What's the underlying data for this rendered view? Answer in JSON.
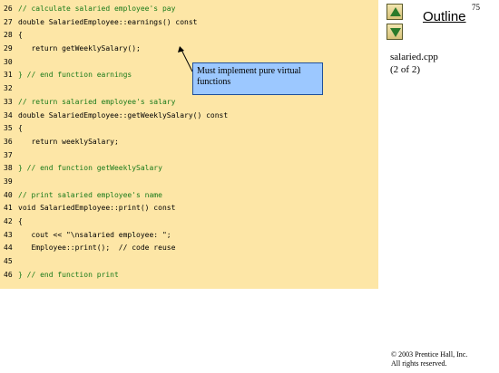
{
  "slide": {
    "page_number": "75",
    "outline_label": "Outline",
    "file_name": "salaried.cpp",
    "page_info": "(2 of 2)",
    "copyright": "© 2003 Prentice Hall, Inc.",
    "rights": "All rights reserved.",
    "callout": "Must implement pure virtual functions"
  },
  "code_lines": [
    {
      "num": "26",
      "text": "// calculate salaried employee's pay",
      "type": "cm"
    },
    {
      "num": "27",
      "text": "double SalariedEmployee::earnings() const",
      "type": "txt"
    },
    {
      "num": "28",
      "text": "{",
      "type": "txt"
    },
    {
      "num": "29",
      "text": "   return getWeeklySalary();",
      "type": "txt"
    },
    {
      "num": "30",
      "text": "",
      "type": "txt"
    },
    {
      "num": "31",
      "text": "} // end function earnings",
      "type": "cm"
    },
    {
      "num": "32",
      "text": "",
      "type": "txt"
    },
    {
      "num": "33",
      "text": "// return salaried employee's salary",
      "type": "cm"
    },
    {
      "num": "34",
      "text": "double SalariedEmployee::getWeeklySalary() const",
      "type": "txt"
    },
    {
      "num": "35",
      "text": "{",
      "type": "txt"
    },
    {
      "num": "36",
      "text": "   return weeklySalary;",
      "type": "txt"
    },
    {
      "num": "37",
      "text": "",
      "type": "txt"
    },
    {
      "num": "38",
      "text": "} // end function getWeeklySalary",
      "type": "cm"
    },
    {
      "num": "39",
      "text": "",
      "type": "txt"
    },
    {
      "num": "40",
      "text": "// print salaried employee's name",
      "type": "cm"
    },
    {
      "num": "41",
      "text": "void SalariedEmployee::print() const",
      "type": "txt"
    },
    {
      "num": "42",
      "text": "{",
      "type": "txt"
    },
    {
      "num": "43",
      "text": "   cout << \"\\nsalaried employee: \";",
      "type": "txt"
    },
    {
      "num": "44",
      "text": "   Employee::print();  // code reuse",
      "type": "txt"
    },
    {
      "num": "45",
      "text": "",
      "type": "txt"
    },
    {
      "num": "46",
      "text": "} // end function print",
      "type": "cm"
    }
  ]
}
